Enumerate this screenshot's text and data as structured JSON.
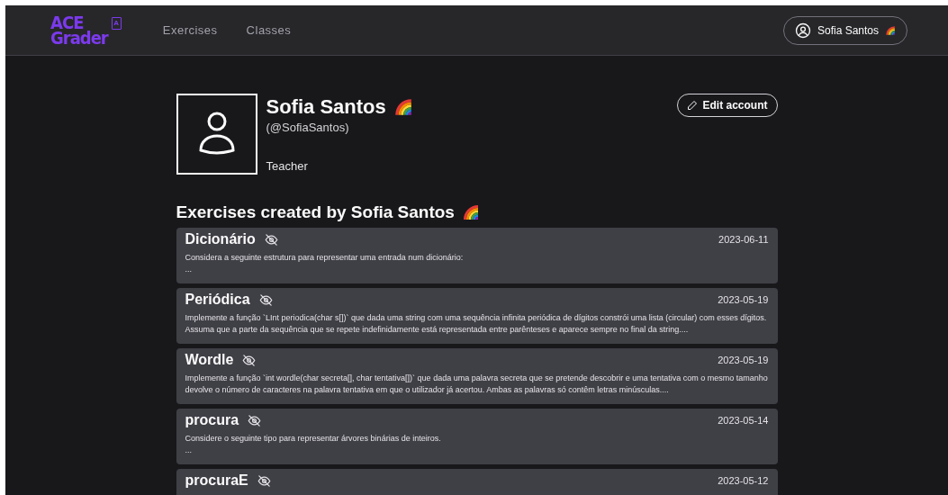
{
  "header": {
    "logo": {
      "line_1": "ACE",
      "line_2": "Grader",
      "badge": "A"
    },
    "nav": [
      {
        "label": "Exercises"
      },
      {
        "label": "Classes"
      }
    ],
    "account_button": {
      "label": "Sofia Santos"
    }
  },
  "profile": {
    "name": "Sofia Santos",
    "username": "(@SofiaSantos)",
    "role": "Teacher",
    "edit_button": "Edit account"
  },
  "exercises_heading": "Exercises created by Sofia Santos",
  "exercises": [
    {
      "title": "Dicionário",
      "hidden": true,
      "date": "2023-06-11",
      "description": [
        "Considera a seguinte estrutura para representar uma entrada num dicionário:",
        "..."
      ]
    },
    {
      "title": "Periódica",
      "hidden": true,
      "date": "2023-05-19",
      "description": [
        "Implemente a função `LInt periodica(char s[])` que dada uma string com uma sequência infinita periódica de dígitos constrói uma lista (circular) com esses dígitos. Assuma que a parte da sequência que se repete indefinidamente está representada entre parênteses e aparece sempre no final da string...."
      ]
    },
    {
      "title": "Wordle",
      "hidden": true,
      "date": "2023-05-19",
      "description": [
        "Implemente a função `int wordle(char secreta[], char tentativa[])` que dada uma palavra secreta que se pretende descobrir e uma tentativa com o mesmo tamanho devolve o número de caracteres na palavra tentativa em que o utilizador já acertou. Ambas as palavras só contêm letras minúsculas...."
      ]
    },
    {
      "title": "procura",
      "hidden": true,
      "date": "2023-05-14",
      "description": [
        "Considere o seguinte tipo para representar árvores binárias de inteiros.",
        "..."
      ]
    },
    {
      "title": "procuraE",
      "hidden": true,
      "date": "2023-05-12"
    }
  ]
}
